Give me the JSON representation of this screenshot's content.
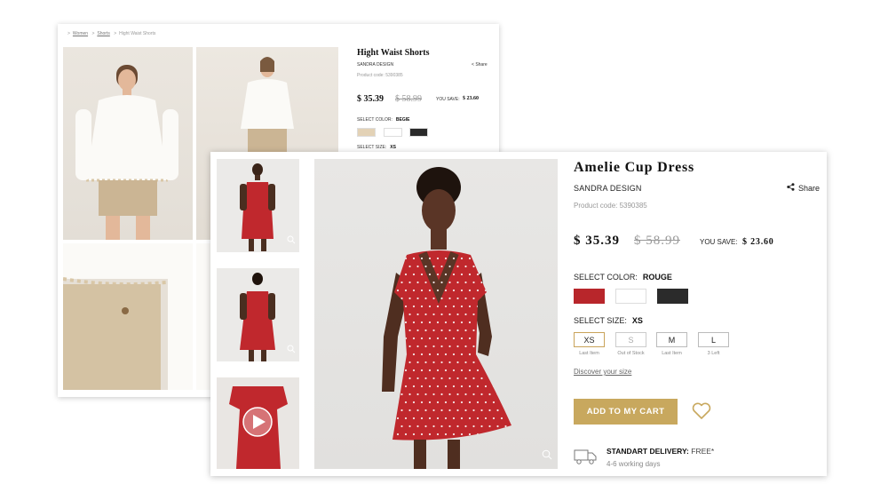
{
  "back_card": {
    "breadcrumb": {
      "women": "Women",
      "shorts": "Shorts",
      "current": "Hight Waist Shorts"
    },
    "product_title": "Hight Waist Shorts",
    "brand": "SANDRA DESIGN",
    "share_label": "Share",
    "product_code": "Product code: 5390385",
    "price": "$ 35.39",
    "old_price": "$ 58.99",
    "you_save_label": "YOU SAVE:",
    "you_save_value": "$ 23.60",
    "select_color_label": "SELECT COLOR:",
    "selected_color": "BEGIE",
    "swatch_colors": [
      "#e3d2b6",
      "#ffffff",
      "#2a2a2a"
    ],
    "select_size_label": "SELECT SIZE:",
    "selected_size": "XS"
  },
  "front_card": {
    "product_title": "Amelie Cup Dress",
    "brand": "SANDRA DESIGN",
    "share_label": "Share",
    "product_code": "Product code: 5390385",
    "price": "$ 35.39",
    "old_price": "$ 58.99",
    "you_save_label": "YOU SAVE:",
    "you_save_value": "$ 23.60",
    "select_color_label": "SELECT COLOR:",
    "selected_color": "ROUGE",
    "swatch_colors": [
      "#b8262b",
      "#ffffff",
      "#2b2b2b"
    ],
    "select_size_label": "SELECT SIZE:",
    "selected_size": "XS",
    "sizes": [
      {
        "label": "XS",
        "note": "Last Item",
        "state": "selected"
      },
      {
        "label": "S",
        "note": "Out of Stock",
        "state": "disabled"
      },
      {
        "label": "M",
        "note": "Last Item",
        "state": "available"
      },
      {
        "label": "L",
        "note": "3 Left",
        "state": "available"
      }
    ],
    "discover_link": "Discover your size",
    "add_to_cart": "ADD TO MY CART",
    "delivery_label": "STANDART DELIVERY:",
    "delivery_value": "FREE*",
    "delivery_days": "4-6 working days",
    "accent_color": "#c8a85e",
    "dress_color": "#c0282d"
  }
}
